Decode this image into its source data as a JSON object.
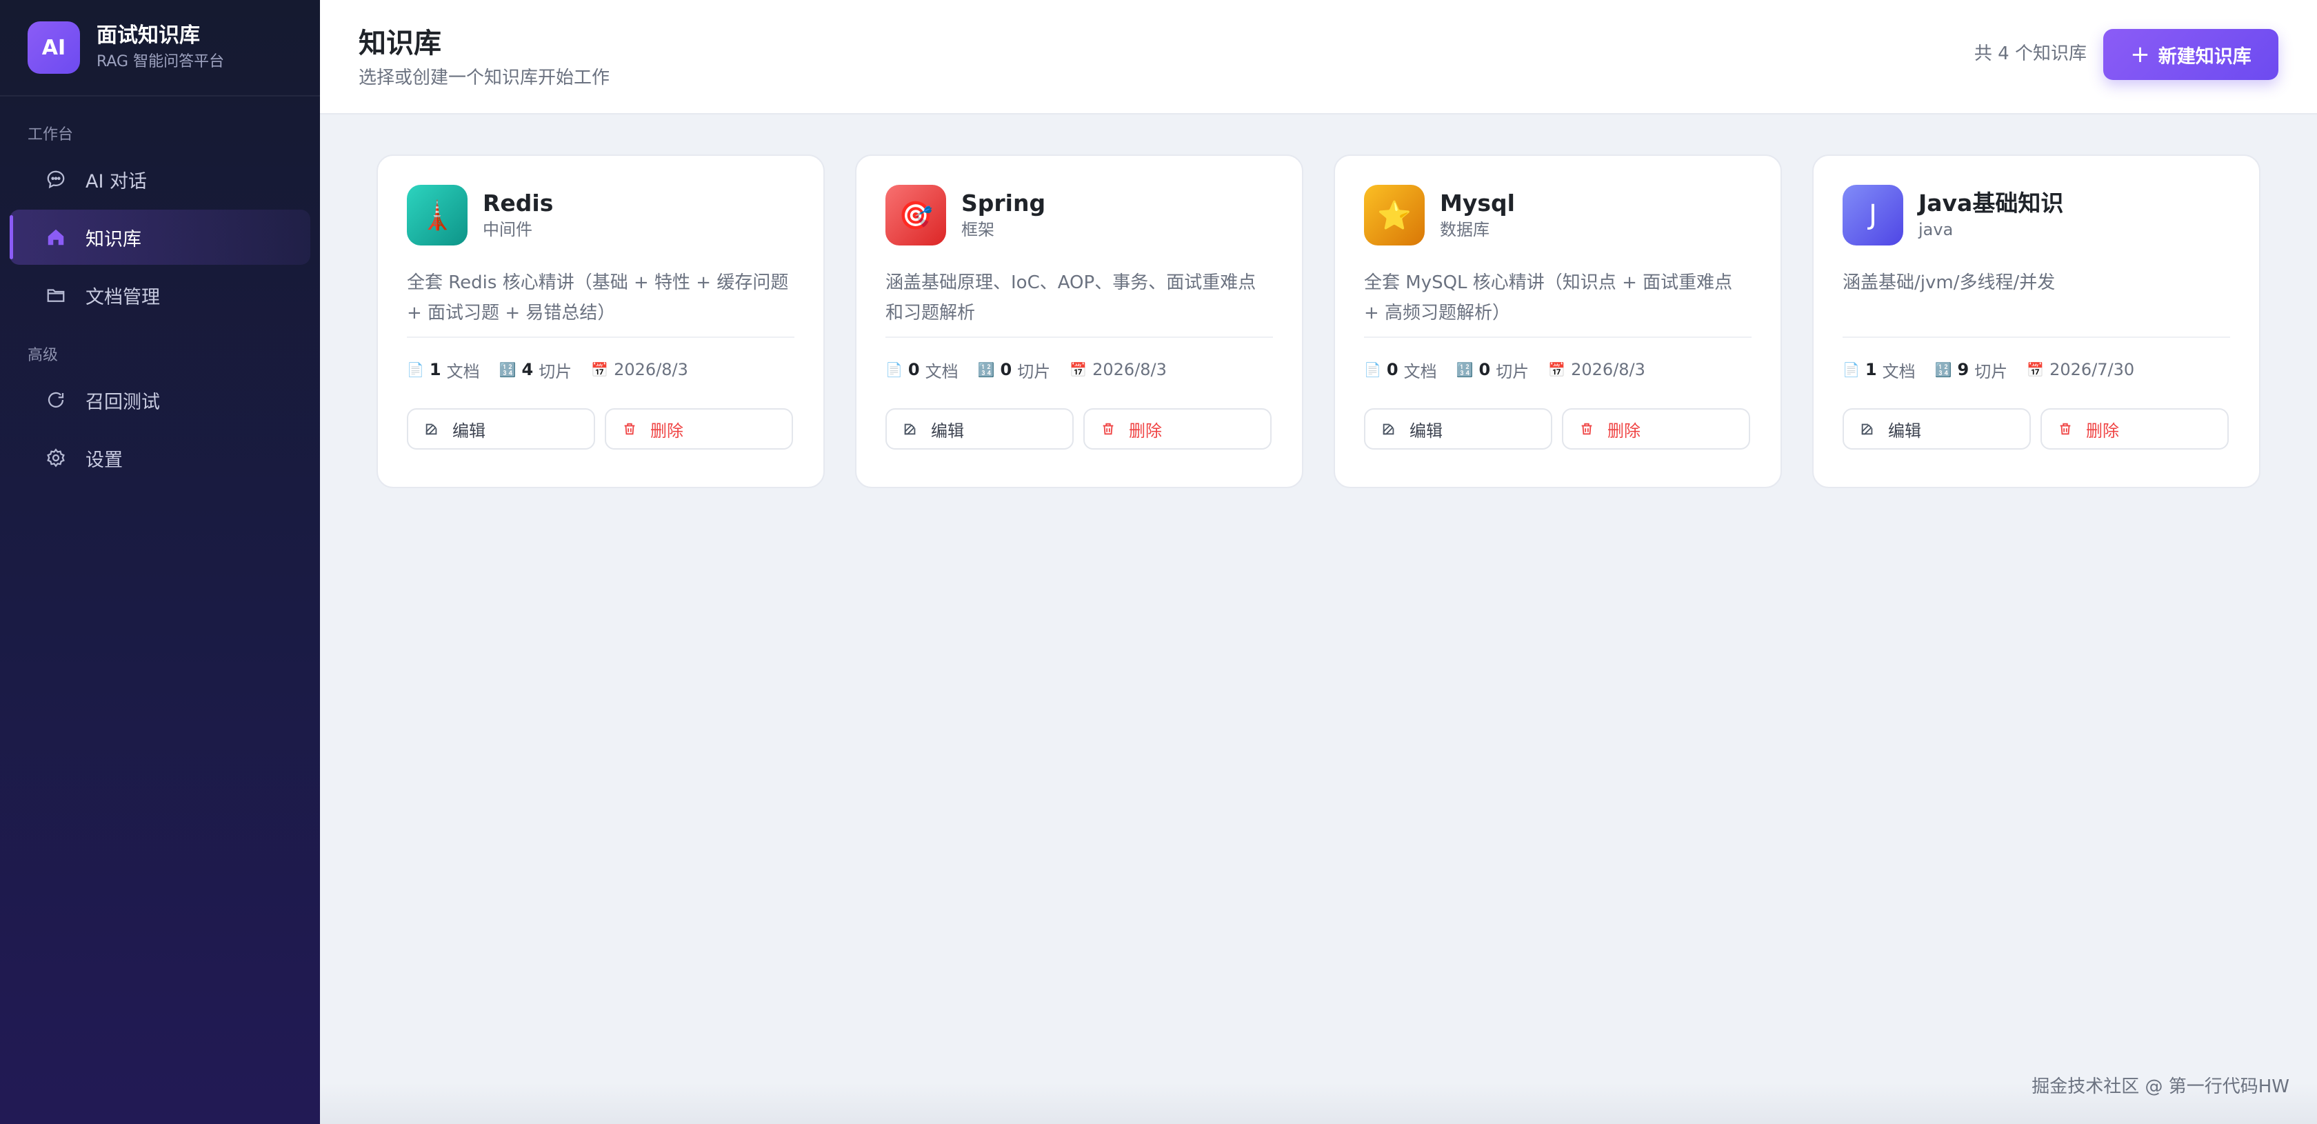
{
  "brand": {
    "logo": "AI",
    "title": "面试知识库",
    "subtitle": "RAG 智能问答平台"
  },
  "nav": {
    "group1": "工作台",
    "group2": "高级",
    "items": [
      {
        "label": "AI 对话",
        "icon": "chat-icon"
      },
      {
        "label": "知识库",
        "icon": "home-icon",
        "active": true
      },
      {
        "label": "文档管理",
        "icon": "folder-icon"
      },
      {
        "label": "召回测试",
        "icon": "refresh-icon"
      },
      {
        "label": "设置",
        "icon": "gear-icon"
      }
    ]
  },
  "header": {
    "title": "知识库",
    "subtitle": "选择或创建一个知识库开始工作",
    "count_text": "共 4 个知识库",
    "new_button": "新建知识库"
  },
  "labels": {
    "docs": "文档",
    "chunks": "切片",
    "edit": "编辑",
    "delete": "删除"
  },
  "cards": [
    {
      "name": "Redis",
      "category": "中间件",
      "icon": "🗼",
      "icon_color": "#14b8a6",
      "description": "全套 Redis 核心精讲（基础 + 特性 + 缓存问题 + 面试习题 + 易错总结）",
      "docs": "1",
      "chunks": "4",
      "date": "2026/8/3"
    },
    {
      "name": "Spring",
      "category": "框架",
      "icon": "🎯",
      "icon_color": "#ef4444",
      "description": "涵盖基础原理、IoC、AOP、事务、面试重难点和习题解析",
      "docs": "0",
      "chunks": "0",
      "date": "2026/8/3"
    },
    {
      "name": "Mysql",
      "category": "数据库",
      "icon": "⭐",
      "icon_color": "#f59e0b",
      "description": "全套 MySQL 核心精讲（知识点 + 面试重难点 + 高频习题解析）",
      "docs": "0",
      "chunks": "0",
      "date": "2026/8/3"
    },
    {
      "name": "Java基础知识",
      "category": "java",
      "icon": "J",
      "icon_color": "#6366f1",
      "description": "涵盖基础/jvm/多线程/并发",
      "docs": "1",
      "chunks": "9",
      "date": "2026/7/30"
    }
  ],
  "watermark": "掘金技术社区 @ 第一行代码HW"
}
